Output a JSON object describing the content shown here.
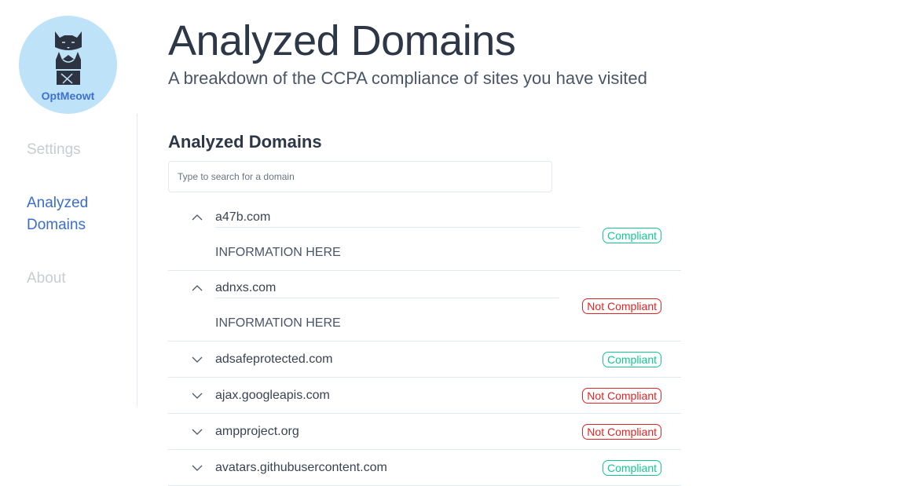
{
  "logo": {
    "text": "OptMeowt",
    "icon": "cat-icon"
  },
  "nav": [
    {
      "label": "Settings",
      "state": "inactive"
    },
    {
      "label": "Analyzed Domains",
      "state": "active"
    },
    {
      "label": "About",
      "state": "inactive"
    }
  ],
  "header": {
    "title": "Analyzed Domains",
    "subtitle": "A breakdown of the CCPA compliance of sites you have visited"
  },
  "section": {
    "title": "Analyzed Domains",
    "search_placeholder": "Type to search for a domain",
    "search_value": ""
  },
  "colors": {
    "compliant": "#10c98f",
    "not_compliant": "#e02424",
    "nav_active": "#3b6ecb",
    "logo_bg": "#bee3f8"
  },
  "domains": [
    {
      "name": "a47b.com",
      "expanded": true,
      "info": "INFORMATION HERE",
      "status": "Compliant",
      "icon": "chevron-up-icon"
    },
    {
      "name": "adnxs.com",
      "expanded": true,
      "info": "INFORMATION HERE",
      "status": "Not Compliant",
      "icon": "chevron-up-icon"
    },
    {
      "name": "adsafeprotected.com",
      "expanded": false,
      "status": "Compliant",
      "icon": "chevron-down-icon"
    },
    {
      "name": "ajax.googleapis.com",
      "expanded": false,
      "status": "Not Compliant",
      "icon": "chevron-down-icon"
    },
    {
      "name": "ampproject.org",
      "expanded": false,
      "status": "Not Compliant",
      "icon": "chevron-down-icon"
    },
    {
      "name": "avatars.githubusercontent.com",
      "expanded": false,
      "status": "Compliant",
      "icon": "chevron-down-icon"
    }
  ]
}
